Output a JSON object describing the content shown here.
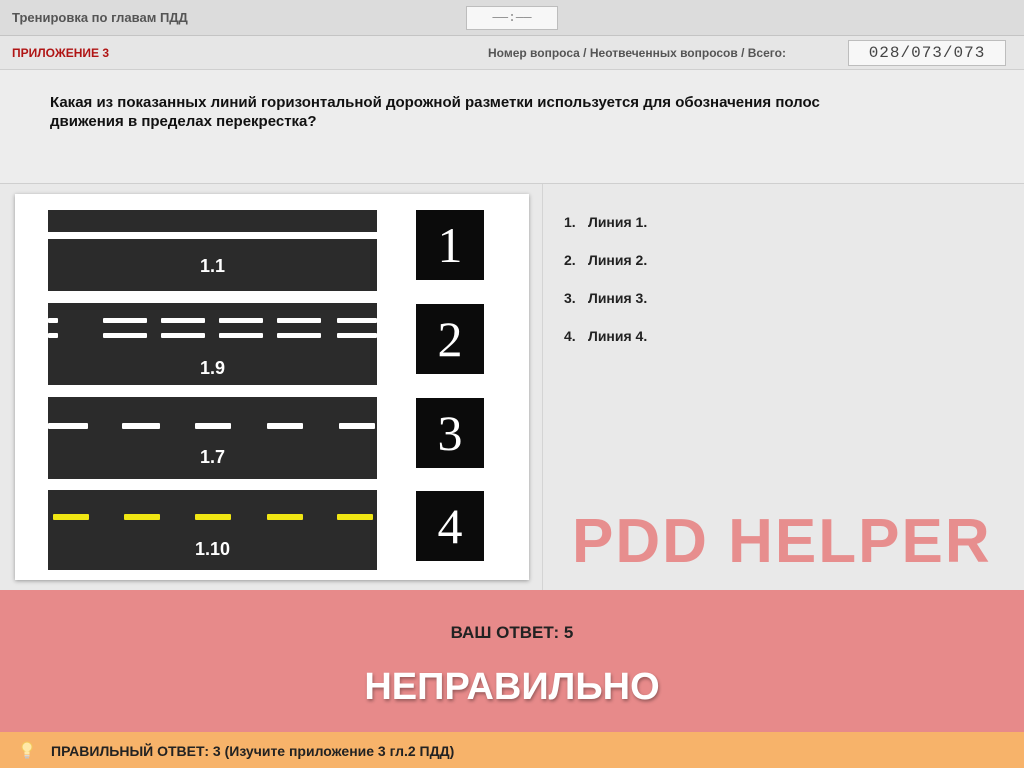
{
  "header": {
    "title": "Тренировка по главам ПДД",
    "timer": "——:——"
  },
  "subheader": {
    "appendix": "ПРИЛОЖЕНИЕ 3",
    "question_label": "Номер вопроса / Неотвеченных вопросов / Всего:",
    "question_counter": "028/073/073"
  },
  "question": {
    "text": "Какая из показанных линий горизонтальной дорожной разметки используется для обозначения полос движения в пределах перекрестка?"
  },
  "image": {
    "lines": [
      {
        "label": "1.1",
        "number": "1"
      },
      {
        "label": "1.9",
        "number": "2"
      },
      {
        "label": "1.7",
        "number": "3"
      },
      {
        "label": "1.10",
        "number": "4"
      }
    ]
  },
  "answers": [
    {
      "num": "1.",
      "text": "Линия 1."
    },
    {
      "num": "2.",
      "text": "Линия 2."
    },
    {
      "num": "3.",
      "text": "Линия 3."
    },
    {
      "num": "4.",
      "text": "Линия 4."
    }
  ],
  "watermark": "PDD HELPER",
  "result": {
    "your_answer": "ВАШ  ОТВЕТ:   5",
    "verdict": "НЕПРАВИЛЬНО"
  },
  "footer": {
    "correct": "ПРАВИЛЬНЫЙ  ОТВЕТ:   3   (Изучите приложение 3 гл.2 ПДД)",
    "icon": "lightbulb-icon"
  },
  "colors": {
    "result_bg": "#e78a8a",
    "footer_bg": "#f7b36a",
    "appendix": "#b01515",
    "yellow_marking": "#f0e613"
  }
}
